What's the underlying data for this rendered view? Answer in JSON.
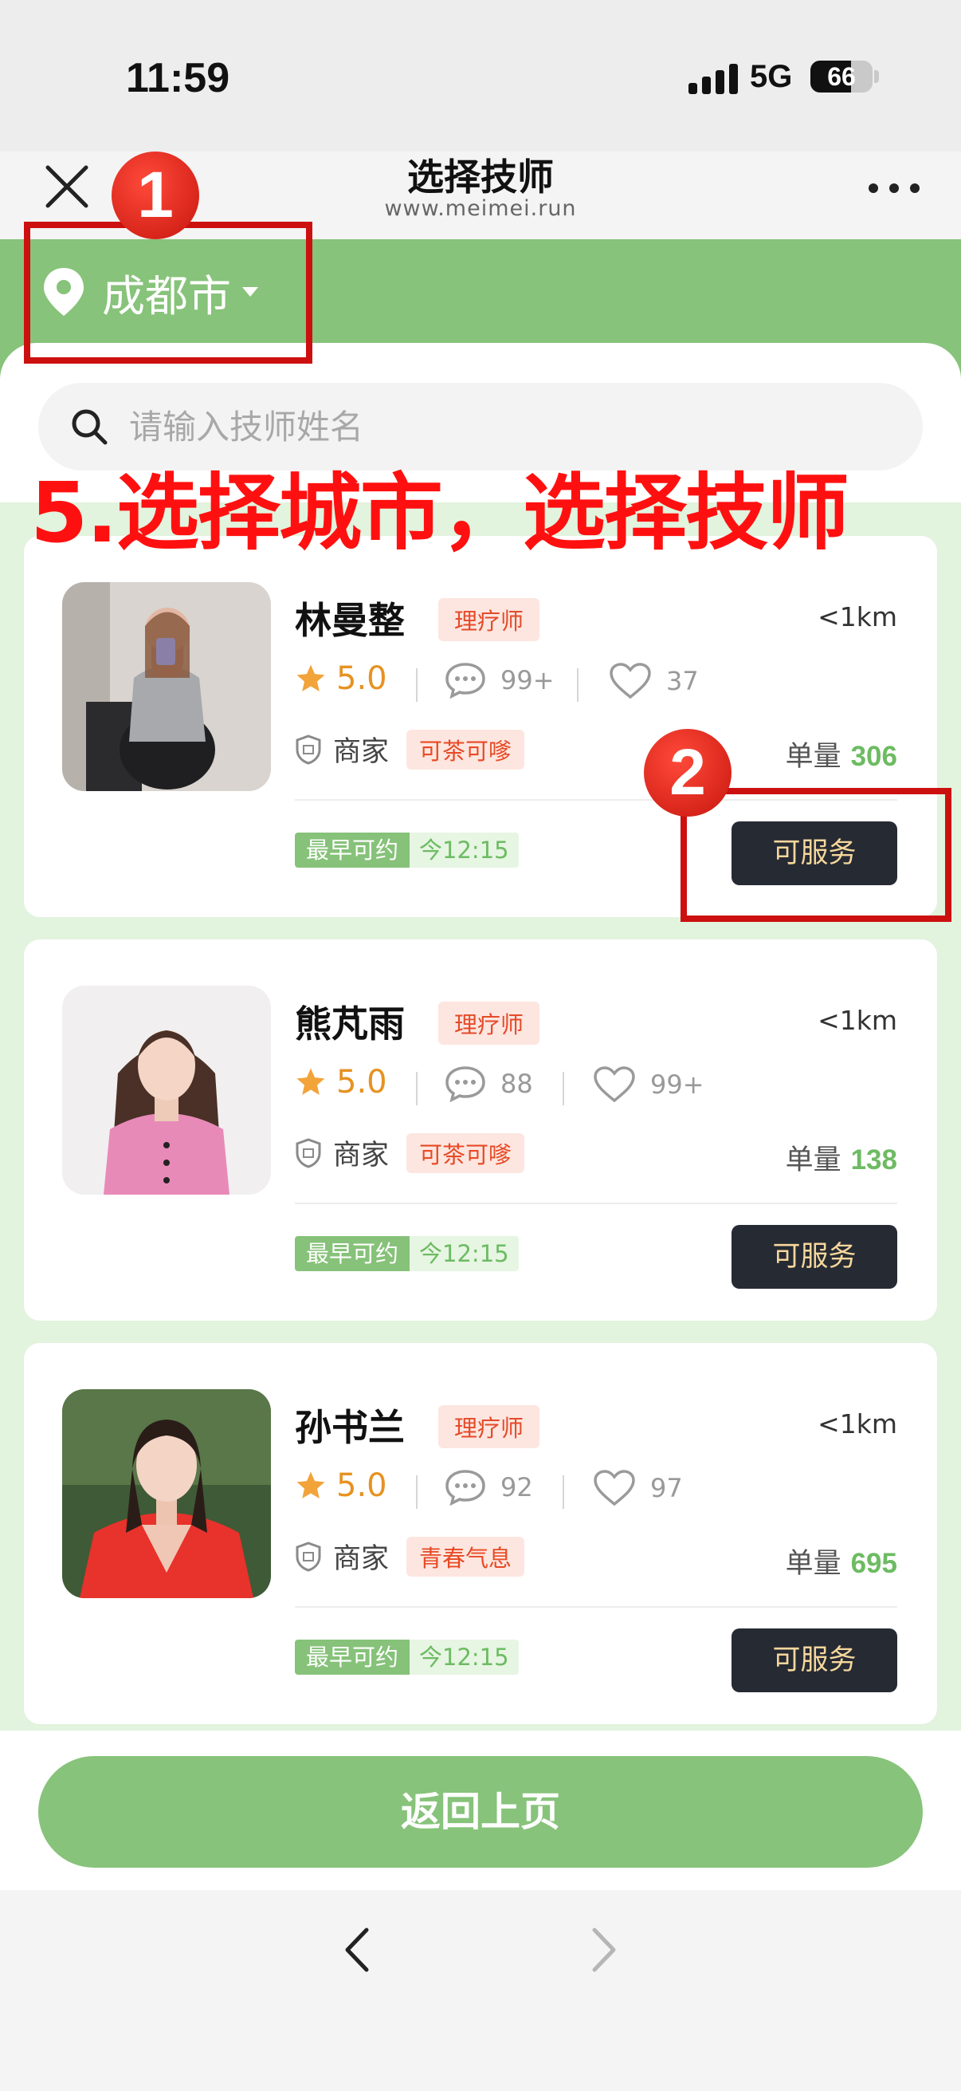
{
  "status_bar": {
    "time": "11:59",
    "network": "5G",
    "battery": "66",
    "battery_level": 0.66
  },
  "nav": {
    "title": "选择技师",
    "url": "www.meimei.run"
  },
  "location": {
    "city": "成都市"
  },
  "search": {
    "placeholder": "请输入技师姓名"
  },
  "overlay": {
    "caption": "5.选择城市，选择技师",
    "badge_1": "1",
    "badge_2": "2"
  },
  "technicians": [
    {
      "name": "林曼整",
      "role": "理疗师",
      "distance": "<1km",
      "rating": "5.0",
      "comments": "99+",
      "likes": "37",
      "shop_label": "商家",
      "trait": "可茶可嗲",
      "orders_label": "单量",
      "orders": "306",
      "appt_label": "最早可约",
      "appt_time": "今12:15",
      "action": "可服务"
    },
    {
      "name": "熊芃雨",
      "role": "理疗师",
      "distance": "<1km",
      "rating": "5.0",
      "comments": "88",
      "likes": "99+",
      "shop_label": "商家",
      "trait": "可茶可嗲",
      "orders_label": "单量",
      "orders": "138",
      "appt_label": "最早可约",
      "appt_time": "今12:15",
      "action": "可服务"
    },
    {
      "name": "孙书兰",
      "role": "理疗师",
      "distance": "<1km",
      "rating": "5.0",
      "comments": "92",
      "likes": "97",
      "shop_label": "商家",
      "trait": "青春气息",
      "orders_label": "单量",
      "orders": "695",
      "appt_label": "最早可约",
      "appt_time": "今12:15",
      "action": "可服务"
    }
  ],
  "footer": {
    "back_label": "返回上页"
  },
  "colors": {
    "accent_green": "#87c37a",
    "button_dark": "#262a33",
    "button_text": "#f6d79c",
    "annotation_red": "#cc1010"
  },
  "icons": [
    "close-icon",
    "more-icon",
    "location-pin-icon",
    "caret-down-icon",
    "search-icon",
    "star-icon",
    "comment-icon",
    "heart-icon",
    "shop-badge-icon",
    "browser-back-icon",
    "browser-forward-icon"
  ]
}
